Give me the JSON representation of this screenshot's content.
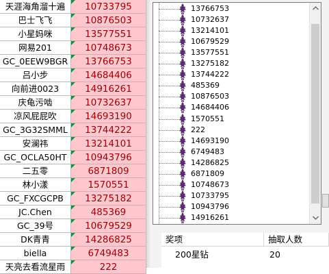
{
  "sheet": {
    "rows": [
      {
        "name": "天涯海角溜十遍",
        "value": "10733795"
      },
      {
        "name": "巴士飞飞",
        "value": "10876503"
      },
      {
        "name": "小星妈咪",
        "value": "13577551"
      },
      {
        "name": "网易201",
        "value": "10748673"
      },
      {
        "name": "GC_0EEW9BGR",
        "value": "13766753"
      },
      {
        "name": "吕小步",
        "value": "14684406"
      },
      {
        "name": "向前进0023",
        "value": "14916261"
      },
      {
        "name": "庆龟污啮",
        "value": "10732637"
      },
      {
        "name": "凉风屁屁吹",
        "value": "14693190"
      },
      {
        "name": "GC_3G32SMML",
        "value": "13744222"
      },
      {
        "name": "安澜祎",
        "value": "13214101"
      },
      {
        "name": "GC_OCLA50HT",
        "value": "10943796"
      },
      {
        "name": "二五零",
        "value": "6871809"
      },
      {
        "name": "林小漾",
        "value": "1570551"
      },
      {
        "name": "GC_FXCGCPB",
        "value": "13275182"
      },
      {
        "name": "JC.Chen",
        "value": "485369"
      },
      {
        "name": "GC_39号",
        "value": "10679529"
      },
      {
        "name": "DK青青",
        "value": "14286825"
      },
      {
        "name": "biella",
        "value": "6749483"
      },
      {
        "name": "天亮去看流星雨",
        "value": "222"
      }
    ],
    "accent_fill": "#ffc7ce",
    "accent_text": "#9c0006"
  },
  "tree": {
    "icon": "node-icon",
    "items": [
      "13766753",
      "10732637",
      "13214101",
      "10679529",
      "13577551",
      "13275182",
      "13744222",
      "485369",
      "10876503",
      "14684406",
      "1570551",
      "222",
      "14693190",
      "6749483",
      "14286825",
      "6871809",
      "10748673",
      "10733795",
      "10943796",
      "14916261"
    ]
  },
  "prize_table": {
    "headers": [
      "奖项",
      "抽取人数"
    ],
    "rows": [
      {
        "prize": "200星钻",
        "count": "20"
      }
    ]
  }
}
